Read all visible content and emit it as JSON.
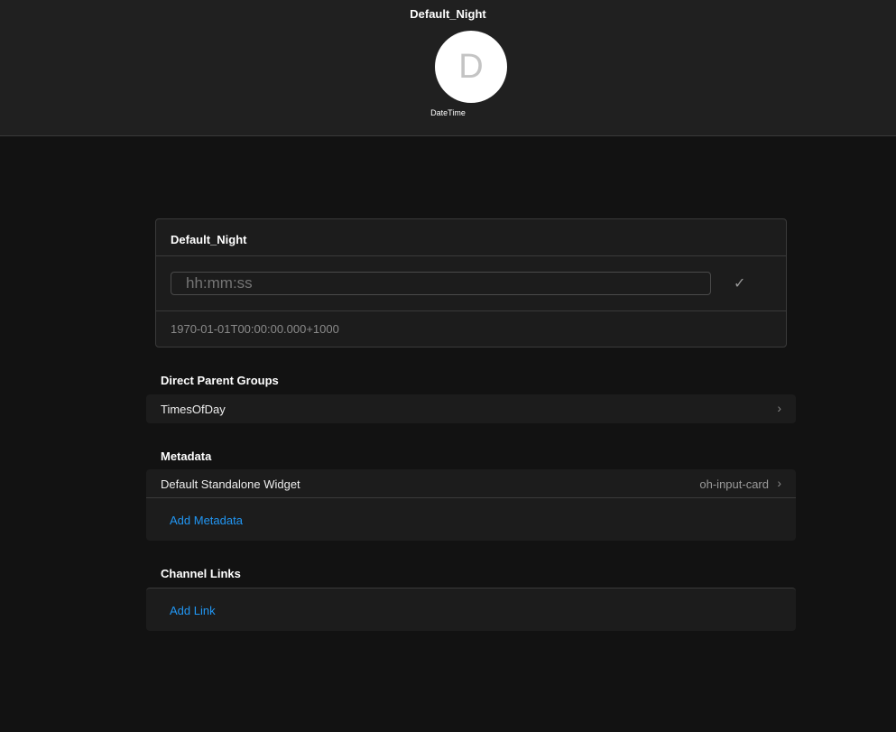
{
  "header": {
    "title": "Default_Night",
    "avatar_letter": "D",
    "type": "DateTime"
  },
  "card": {
    "title": "Default_Night",
    "input_placeholder": "hh:mm:ss",
    "state": "1970-01-01T00:00:00.000+1000"
  },
  "parent_groups": {
    "title": "Direct Parent Groups",
    "items": [
      {
        "label": "TimesOfDay"
      }
    ]
  },
  "metadata": {
    "title": "Metadata",
    "items": [
      {
        "label": "Default Standalone Widget",
        "value": "oh-input-card"
      }
    ],
    "add_label": "Add Metadata"
  },
  "channel_links": {
    "title": "Channel Links",
    "add_label": "Add Link"
  }
}
